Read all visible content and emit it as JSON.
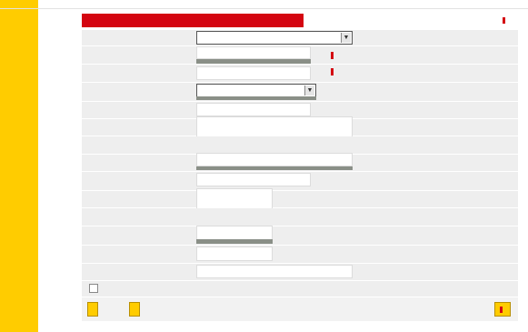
{
  "form": {
    "title": "",
    "top_link": "",
    "fields": [
      {
        "label": "",
        "value": ""
      },
      {
        "label": "",
        "value": ""
      },
      {
        "label": "",
        "value": ""
      },
      {
        "label": "",
        "value": ""
      },
      {
        "label": "",
        "value": ""
      },
      {
        "label": "",
        "value": ""
      },
      {
        "label": "",
        "value": ""
      },
      {
        "label": "",
        "value": ""
      },
      {
        "label": "",
        "value": ""
      },
      {
        "label": "",
        "value": ""
      },
      {
        "label": "",
        "value": ""
      },
      {
        "label": "",
        "value": ""
      },
      {
        "label": "",
        "value": ""
      },
      {
        "label": "",
        "value": ""
      }
    ],
    "aside_links": [
      "",
      ""
    ],
    "checkbox_label": "",
    "buttons": {
      "cancel": "",
      "clear": "",
      "next": ""
    }
  },
  "colors": {
    "accent_yellow": "#ffcc00",
    "accent_red": "#d40511"
  }
}
